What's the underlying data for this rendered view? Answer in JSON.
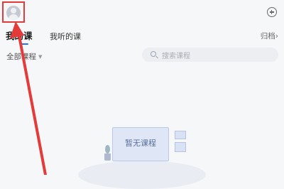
{
  "header": {
    "avatar_icon": "user-avatar-icon",
    "add_icon": "plus-circle-icon"
  },
  "tabs": [
    {
      "label": "我的课",
      "active": true
    },
    {
      "label": "我听的课",
      "active": false
    }
  ],
  "archive_label": "归档",
  "archive_chevron": "›",
  "filter": {
    "label": "全部课程",
    "caret": "▼"
  },
  "search": {
    "placeholder": "搜索课程"
  },
  "empty_state": {
    "text": "暂无课程"
  },
  "annotation": {
    "color": "#e33a3a"
  },
  "accent_color": "#2e6bf0"
}
